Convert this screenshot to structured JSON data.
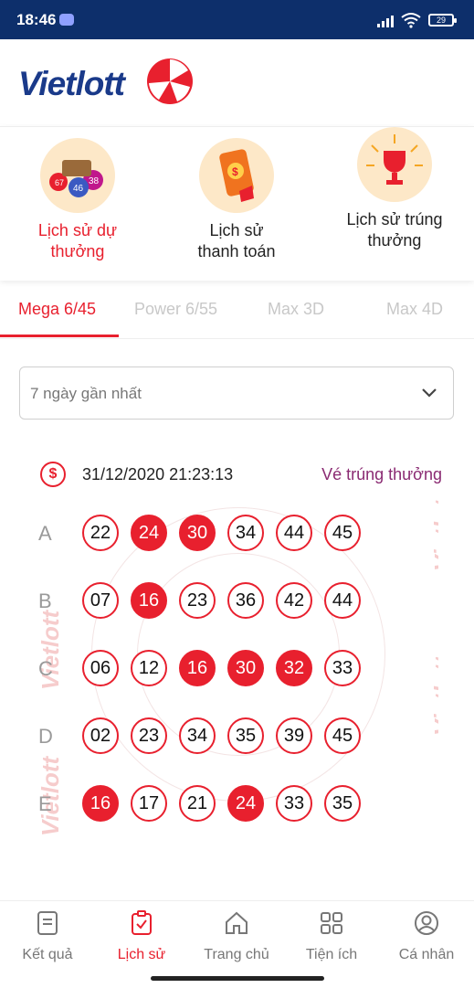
{
  "status": {
    "time": "18:46",
    "battery": "29"
  },
  "brand": {
    "name": "Vietlott",
    "color": "#1a3a8a",
    "accent": "#e8202e"
  },
  "quick_actions": [
    {
      "label_line1": "Lịch sử dự",
      "label_line2": "thưởng",
      "icon": "lottery-balls-icon",
      "active": true
    },
    {
      "label_line1": "Lịch sử",
      "label_line2": "thanh toán",
      "icon": "phone-payment-icon",
      "active": false
    },
    {
      "label_line1": "Lịch sử trúng",
      "label_line2": "thưởng",
      "icon": "trophy-icon",
      "active": false
    }
  ],
  "tabs": [
    {
      "label": "Mega 6/45",
      "active": true
    },
    {
      "label": "Power 6/55",
      "active": false
    },
    {
      "label": "Max 3D",
      "active": false
    },
    {
      "label": "Max 4D",
      "active": false
    }
  ],
  "filter": {
    "value": "7 ngày gần nhất"
  },
  "ticket": {
    "datetime": "31/12/2020 21:23:13",
    "win_link": "Vé trúng thưởng",
    "rows": [
      {
        "letter": "A",
        "numbers": [
          "22",
          "24",
          "30",
          "34",
          "44",
          "45"
        ],
        "hits": [
          false,
          true,
          true,
          false,
          false,
          false
        ]
      },
      {
        "letter": "B",
        "numbers": [
          "07",
          "16",
          "23",
          "36",
          "42",
          "44"
        ],
        "hits": [
          false,
          true,
          false,
          false,
          false,
          false
        ]
      },
      {
        "letter": "C",
        "numbers": [
          "06",
          "12",
          "16",
          "30",
          "32",
          "33"
        ],
        "hits": [
          false,
          false,
          true,
          true,
          true,
          false
        ]
      },
      {
        "letter": "D",
        "numbers": [
          "02",
          "23",
          "34",
          "35",
          "39",
          "45"
        ],
        "hits": [
          false,
          false,
          false,
          false,
          false,
          false
        ]
      },
      {
        "letter": "E",
        "numbers": [
          "16",
          "17",
          "21",
          "24",
          "33",
          "35"
        ],
        "hits": [
          true,
          false,
          false,
          true,
          false,
          false
        ]
      }
    ]
  },
  "bottom_nav": [
    {
      "label": "Kết quả",
      "icon": "results-icon",
      "active": false
    },
    {
      "label": "Lịch sử",
      "icon": "history-icon",
      "active": true
    },
    {
      "label": "Trang chủ",
      "icon": "home-icon",
      "active": false
    },
    {
      "label": "Tiện ích",
      "icon": "utilities-icon",
      "active": false
    },
    {
      "label": "Cá nhân",
      "icon": "profile-icon",
      "active": false
    }
  ]
}
